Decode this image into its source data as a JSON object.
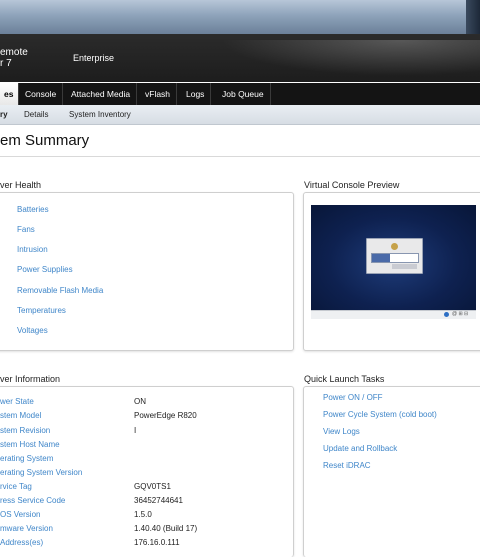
{
  "header": {
    "brand_line1": "emote",
    "brand_line2": "r 7",
    "edition": "Enterprise"
  },
  "tabs": [
    {
      "label": "es",
      "active": true
    },
    {
      "label": "Console"
    },
    {
      "label": "Attached Media"
    },
    {
      "label": "vFlash"
    },
    {
      "label": "Logs"
    },
    {
      "label": "Job Queue"
    }
  ],
  "subtabs": [
    {
      "label": "ry",
      "active": true
    },
    {
      "label": "Details"
    },
    {
      "label": "System Inventory"
    }
  ],
  "page_title": "em Summary",
  "server_health": {
    "title": "ver Health",
    "items": [
      "Batteries",
      "Fans",
      "Intrusion",
      "Power Supplies",
      "Removable Flash Media",
      "Temperatures",
      "Voltages"
    ]
  },
  "console_preview": {
    "title": "Virtual Console Preview",
    "status_text": "@ ⊞ ⊟"
  },
  "server_info": {
    "title": "ver Information",
    "rows": [
      {
        "label": "wer State",
        "value": "ON"
      },
      {
        "label": "stem Model",
        "value": "PowerEdge R820"
      },
      {
        "label": "stem Revision",
        "value": "I"
      },
      {
        "label": "stem Host Name",
        "value": ""
      },
      {
        "label": "erating System",
        "value": ""
      },
      {
        "label": "erating System Version",
        "value": ""
      },
      {
        "label": "rvice Tag",
        "value": "GQV0TS1"
      },
      {
        "label": "ress Service Code",
        "value": "36452744641"
      },
      {
        "label": "OS Version",
        "value": "1.5.0"
      },
      {
        "label": "mware Version",
        "value": "1.40.40 (Build 17)"
      },
      {
        "label": "Address(es)",
        "value": "176.16.0.111"
      }
    ]
  },
  "quick_launch": {
    "title": "Quick Launch Tasks",
    "items": [
      "Power ON / OFF",
      "Power Cycle System (cold boot)",
      "View Logs",
      "Update and Rollback",
      "Reset iDRAC"
    ]
  },
  "colors": {
    "link": "#3f86c9",
    "health_ok": "#4c8a1d",
    "header_bg": "#1d1d1d"
  }
}
